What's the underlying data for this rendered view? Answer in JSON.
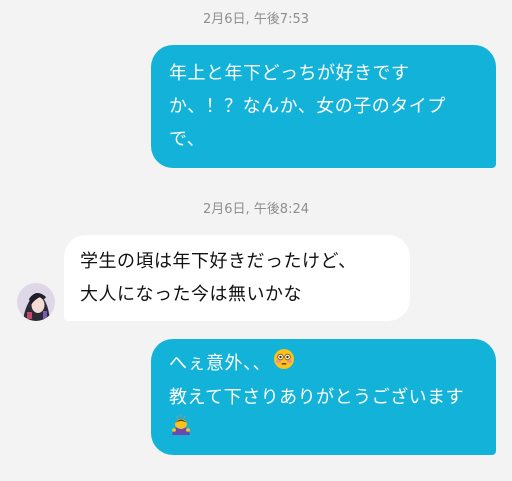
{
  "conversation": {
    "timestamp_1": "2月6日, 午後7:53",
    "message_1": {
      "sender": "me",
      "lines": [
        "年上と年下どっちが好きです",
        "か、！？なんか、女の子のタイプ",
        "で、"
      ]
    },
    "timestamp_2": "2月6日, 午後8:24",
    "message_2": {
      "sender": "them",
      "lines": [
        "学生の頃は年下好きだったけど、",
        "大人になった今は無いかな"
      ]
    },
    "message_3": {
      "sender": "me",
      "lines": [
        "へぇ意外、、",
        "教えて下さりありがとうございます"
      ],
      "emojis": [
        "flushed-face-emoji",
        "bowing-person-emoji"
      ]
    }
  },
  "colors": {
    "sent_bubble": "#13b2d8",
    "received_bubble": "#ffffff",
    "background": "#f3f3f3",
    "timestamp_text": "#8e8e93"
  }
}
